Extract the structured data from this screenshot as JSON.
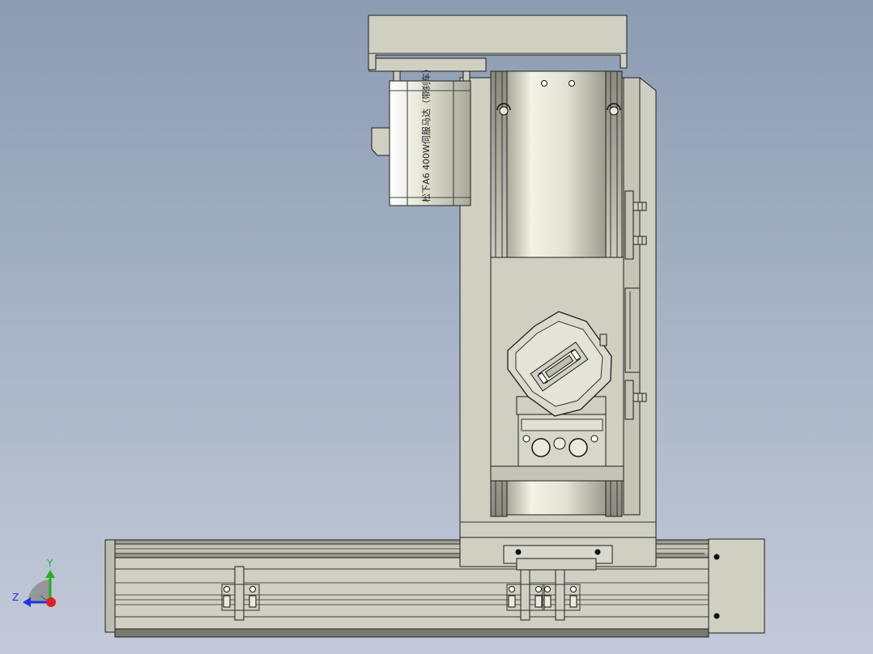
{
  "viewport": {
    "background_top": "#8c9cb2",
    "background_bottom": "#c3cad9"
  },
  "model": {
    "part_color": "#cfcfc2",
    "shadow_color": "#a9a99c",
    "edge_color": "#1e1e1e",
    "motor_label": "松下A6 400W伺服马达（带刹车）"
  },
  "triad": {
    "y_label": "Y",
    "z_label": "Z",
    "y_color": "#1fb31f",
    "z_color": "#1f33e0",
    "x_color": "#e01f1f"
  }
}
